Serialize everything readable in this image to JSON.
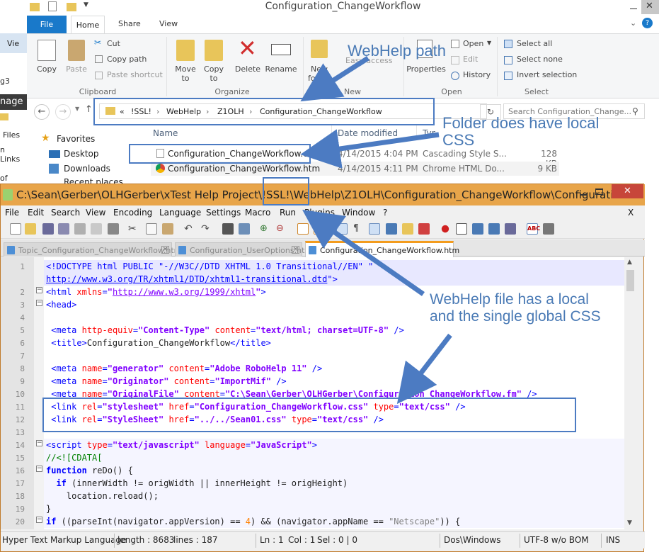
{
  "explorer": {
    "title": "Configuration_ChangeWorkflow",
    "tabs": {
      "file": "File",
      "home": "Home",
      "share": "Share",
      "view": "View"
    },
    "clipboard": {
      "copy": "Copy",
      "paste": "Paste",
      "cut": "Cut",
      "copy_path": "Copy path",
      "paste_shortcut": "Paste shortcut",
      "group": "Clipboard"
    },
    "organize": {
      "move_to": "Move\nto",
      "copy_to": "Copy\nto",
      "delete": "Delete",
      "rename": "Rename",
      "group": "Organize"
    },
    "new": {
      "new_folder": "New\nfolder",
      "easy_access": "Easy access",
      "group": "New"
    },
    "open": {
      "properties": "Properties",
      "open": "Open",
      "edit": "Edit",
      "history": "History",
      "group": "Open"
    },
    "select": {
      "select_all": "Select all",
      "select_none": "Select none",
      "invert": "Invert selection",
      "group": "Select"
    },
    "breadcrumb": [
      "«",
      "!SSL!",
      "WebHelp",
      "Z1OLH",
      "Configuration_ChangeWorkflow"
    ],
    "search_placeholder": "Search Configuration_Change...",
    "nav": {
      "favorites": "Favorites",
      "desktop": "Desktop",
      "downloads": "Downloads",
      "recent": "Recent places"
    },
    "columns": {
      "name": "Name",
      "date": "Date modified",
      "type": "Type"
    },
    "files": [
      {
        "name": "Configuration_ChangeWorkflow.css",
        "date": "4/14/2015 4:04 PM",
        "type": "Cascading Style S...",
        "size": "128 KB"
      },
      {
        "name": "Configuration_ChangeWorkflow.htm",
        "date": "4/14/2015 4:11 PM",
        "type": "Chrome HTML Do...",
        "size": "9 KB"
      }
    ]
  },
  "background_window": {
    "items": [
      "Vie",
      "g3",
      "nage",
      "Files",
      "n Links",
      "of Com"
    ]
  },
  "npp": {
    "title": "C:\\Sean\\Gerber\\OLHGerber\\xTest Help Project\\!SSL!\\WebHelp\\Z1OLH\\Configuration_ChangeWorkflow\\Configuration...",
    "menu": [
      "File",
      "Edit",
      "Search",
      "View",
      "Encoding",
      "Language",
      "Settings",
      "Macro",
      "Run",
      "Plugins",
      "Window",
      "?"
    ],
    "menu_close": "X",
    "tabs": [
      "Topic_Configuration_ChangeWorkflow.htm",
      "Configuration_UserOptions.htm",
      "Configuration_ChangeWorkflow.htm"
    ],
    "status": {
      "language": "Hyper Text Markup Language",
      "length": "length : 8683",
      "lines": "lines : 187",
      "ln": "Ln : 1",
      "col": "Col : 1",
      "sel": "Sel : 0 | 0",
      "eol": "Dos\\Windows",
      "encoding": "UTF-8 w/o BOM",
      "ins": "INS"
    },
    "line_numbers": [
      "1",
      "2",
      "3",
      "4",
      "5",
      "6",
      "7",
      "8",
      "9",
      "10",
      "11",
      "12",
      "13",
      "14",
      "15",
      "16",
      "17",
      "18",
      "19",
      "20"
    ]
  },
  "callouts": {
    "webhelp_path": "WebHelp path",
    "folder_css": "Folder does have local\nCSS",
    "webhelp_file": "WebHelp file has a local\nand the single global CSS"
  },
  "colors": {
    "accent_blue": "#4c7bc2",
    "npp_title": "#e8a54a",
    "file_tab": "#1979ca"
  }
}
